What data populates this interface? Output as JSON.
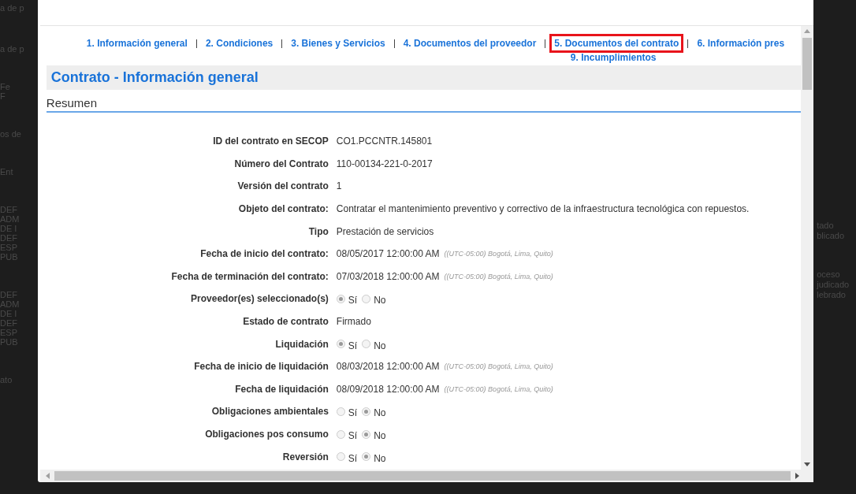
{
  "backdrop": {
    "left_fragments": [
      "a de p",
      "a de p",
      "Fe",
      "F",
      "os de",
      "Ent",
      "DEF",
      "ADM",
      "DE I",
      "DEF",
      "ESP",
      "PUB",
      "DEF",
      "ADM",
      "DE I",
      "DEF",
      "ESP",
      "PUB",
      "ato"
    ],
    "right_fragments": [
      "tado",
      "blicado",
      "oceso",
      "judicado",
      "lebrado"
    ]
  },
  "nav": {
    "items": [
      {
        "label": "1. Información general",
        "selected": false
      },
      {
        "label": "2. Condiciones",
        "selected": false
      },
      {
        "label": "3. Bienes y Servicios",
        "selected": false
      },
      {
        "label": "4. Documentos del proveedor",
        "selected": false
      },
      {
        "label": "5. Documentos del contrato",
        "selected": true
      },
      {
        "label": "6. Información pres",
        "selected": false
      }
    ],
    "second_line": [
      "9. Incumplimientos"
    ]
  },
  "title": "Contrato - Información general",
  "section": "Resumen",
  "rows": [
    {
      "kind": "text",
      "label": "ID del contrato en SECOP",
      "value": "CO1.PCCNTR.145801"
    },
    {
      "kind": "text",
      "label": "Número del Contrato",
      "value": "110-00134-221-0-2017"
    },
    {
      "kind": "text",
      "label": "Versión del contrato",
      "value": "1"
    },
    {
      "kind": "text",
      "label": "Objeto del contrato:",
      "value": "Contratar el mantenimiento preventivo y correctivo de la infraestructura tecnológica con repuestos."
    },
    {
      "kind": "text",
      "label": "Tipo",
      "value": "Prestación de servicios"
    },
    {
      "kind": "text",
      "label": "Fecha de inicio del contrato:",
      "value": "08/05/2017 12:00:00 AM",
      "note": "((UTC-05:00) Bogotá, Lima, Quito)"
    },
    {
      "kind": "text",
      "label": "Fecha de terminación del contrato:",
      "value": "07/03/2018 12:00:00 AM",
      "note": "((UTC-05:00) Bogotá, Lima, Quito)"
    },
    {
      "kind": "radio",
      "label": "Proveedor(es) seleccionado(s)",
      "options": [
        {
          "label": "Sí",
          "selected": true
        },
        {
          "label": "No",
          "selected": false
        }
      ]
    },
    {
      "kind": "text",
      "label": "Estado de contrato",
      "value": "Firmado"
    },
    {
      "kind": "radio",
      "label": "Liquidación",
      "options": [
        {
          "label": "Sí",
          "selected": true
        },
        {
          "label": "No",
          "selected": false
        }
      ]
    },
    {
      "kind": "text",
      "label": "Fecha de inicio de liquidación",
      "value": "08/03/2018 12:00:00 AM",
      "note": "((UTC-05:00) Bogotá, Lima, Quito)"
    },
    {
      "kind": "text",
      "label": "Fecha de liquidación",
      "value": "08/09/2018 12:00:00 AM",
      "note": "((UTC-05:00) Bogotá, Lima, Quito)"
    },
    {
      "kind": "radio",
      "label": "Obligaciones ambientales",
      "options": [
        {
          "label": "Sí",
          "selected": false
        },
        {
          "label": "No",
          "selected": true
        }
      ]
    },
    {
      "kind": "radio",
      "label": "Obligaciones pos consumo",
      "options": [
        {
          "label": "Sí",
          "selected": false
        },
        {
          "label": "No",
          "selected": true
        }
      ]
    },
    {
      "kind": "radio",
      "label": "Reversión",
      "options": [
        {
          "label": "Sí",
          "selected": false
        },
        {
          "label": "No",
          "selected": true
        }
      ]
    }
  ]
}
